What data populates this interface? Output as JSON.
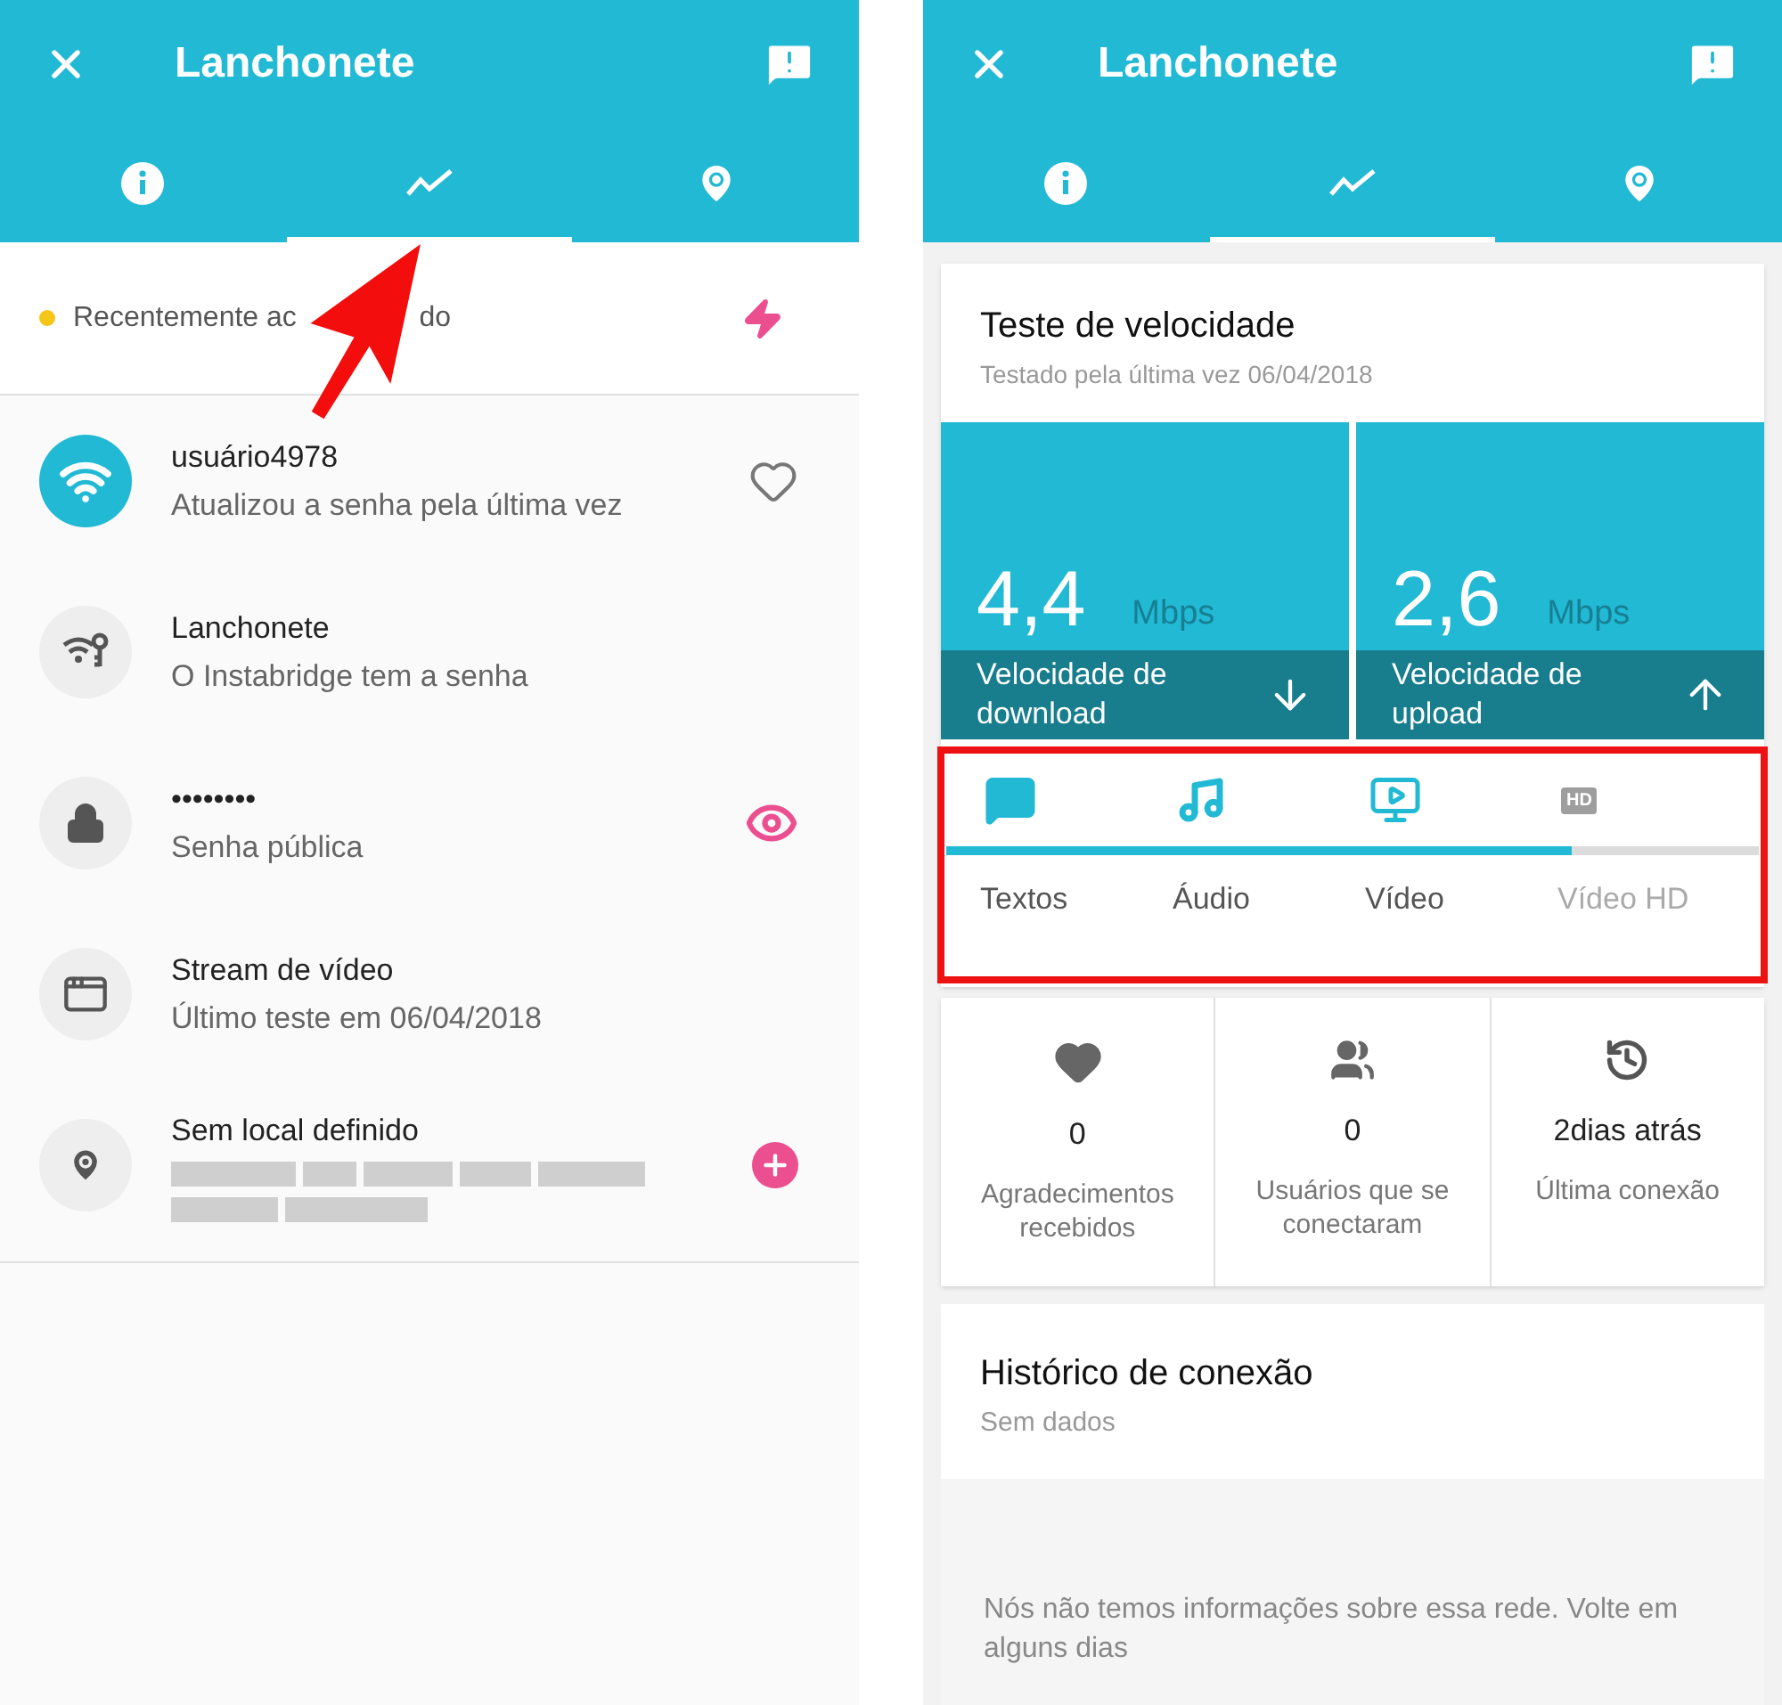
{
  "left_screen": {
    "header": {
      "title": "Lanchonete",
      "tabs": [
        {
          "kind": "info",
          "selected": false
        },
        {
          "kind": "stats",
          "selected": true
        },
        {
          "kind": "location",
          "selected": false
        }
      ]
    },
    "status": {
      "parts": [
        "Recentemente ac",
        "do"
      ],
      "color": "#f5c518"
    },
    "items": [
      {
        "kind": "hotspot",
        "title": "usuário4978",
        "subtitle": "Atualizou a senha pela última vez",
        "action": {
          "kind": "heart"
        }
      },
      {
        "kind": "wifi-key",
        "title": "Lanchonete",
        "subtitle": "O Instabridge tem a senha"
      },
      {
        "kind": "lock",
        "title": "••••••••",
        "subtitle": "Senha pública",
        "action": {
          "kind": "eye"
        }
      },
      {
        "kind": "window",
        "title": "Stream de vídeo",
        "subtitle": "Último teste em 06/04/2018"
      },
      {
        "kind": "pin",
        "title": "Sem local definido",
        "redacted": true,
        "action": {
          "kind": "add"
        }
      }
    ]
  },
  "right_screen": {
    "header": {
      "title": "Lanchonete",
      "tabs": [
        {
          "kind": "info",
          "selected": false
        },
        {
          "kind": "stats",
          "selected": true
        },
        {
          "kind": "location",
          "selected": false
        }
      ]
    },
    "speed_test": {
      "title": "Teste de velocidade",
      "subtitle": "Testado pela última vez 06/04/2018",
      "results": [
        {
          "value": "4,4",
          "unit": "Mbps",
          "label": "Velocidade de download",
          "kind": "download"
        },
        {
          "value": "2,6",
          "unit": "Mbps",
          "label": "Velocidade de upload",
          "kind": "upload"
        }
      ],
      "usage": {
        "level": 0.77,
        "items": [
          {
            "kind": "text",
            "label": "Textos",
            "reached": true
          },
          {
            "kind": "audio",
            "label": "Áudio",
            "reached": true
          },
          {
            "kind": "video",
            "label": "Vídeo",
            "reached": true
          },
          {
            "kind": "hd",
            "icon_text": "HD",
            "label": "Vídeo HD",
            "reached": false
          }
        ]
      }
    },
    "stats": [
      {
        "kind": "thanks",
        "value": "0",
        "label": "Agradecimentos recebidos"
      },
      {
        "kind": "users",
        "value": "0",
        "label": "Usuários que se conectaram"
      },
      {
        "kind": "history",
        "value": "2dias atrás",
        "label": "Última conexão"
      }
    ],
    "history": {
      "title": "Histórico de conexão",
      "subtitle": "Sem dados",
      "message": "Nós não temos informações sobre essa rede. Volte em alguns dias"
    }
  }
}
